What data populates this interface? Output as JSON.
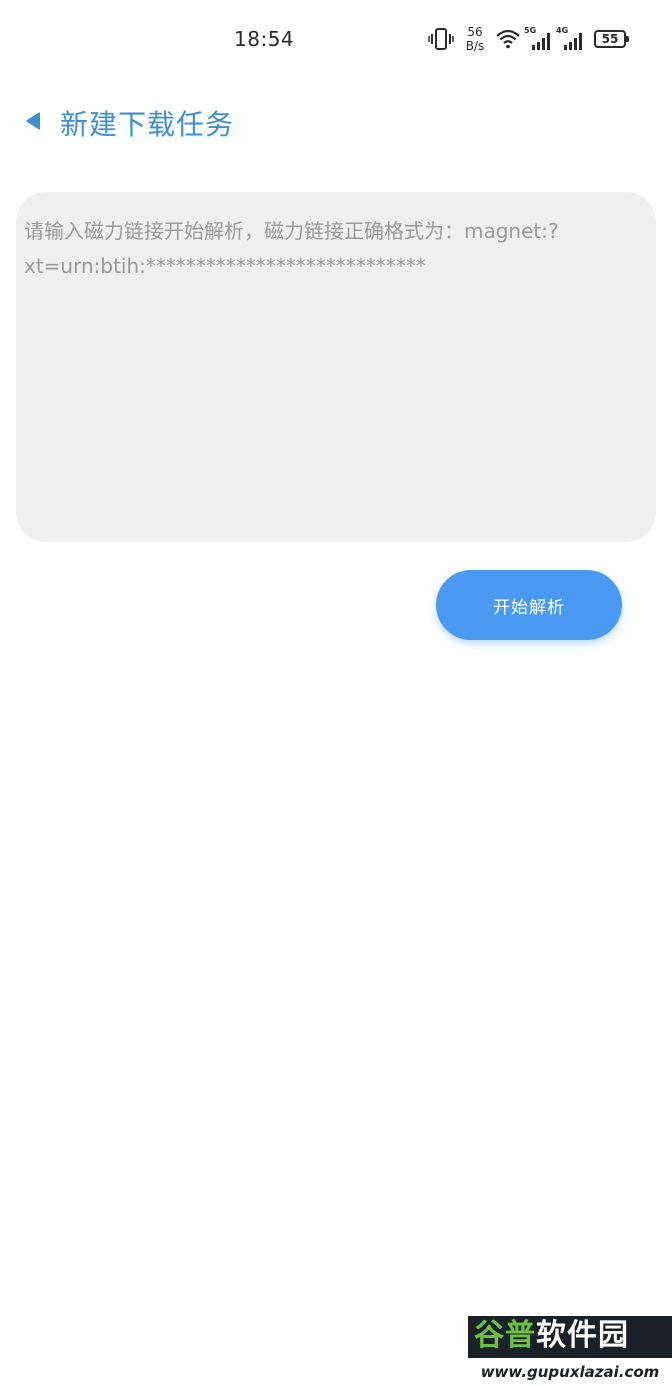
{
  "status_bar": {
    "time": "18:54",
    "net_speed_value": "56",
    "net_speed_unit": "B/s",
    "signal_1_tag": "5G",
    "signal_2_tag": "4G",
    "battery": "55",
    "icons": [
      "vibrate-icon",
      "wifi-icon",
      "signal-icon",
      "battery-icon"
    ]
  },
  "header": {
    "title": "新建下载任务",
    "back_icon": "back-arrow-icon",
    "accent_color": "#3c8fd0"
  },
  "magnet_input": {
    "value": "",
    "placeholder": "请输入磁力链接开始解析，磁力链接正确格式为：magnet:?xt=urn:btih:****************************"
  },
  "start_button": {
    "label": "开始解析",
    "color": "#4a9af4"
  },
  "watermark": {
    "brand_part1": "谷普",
    "brand_part2": "软件园",
    "url": "www.gupuxlazai.com"
  }
}
